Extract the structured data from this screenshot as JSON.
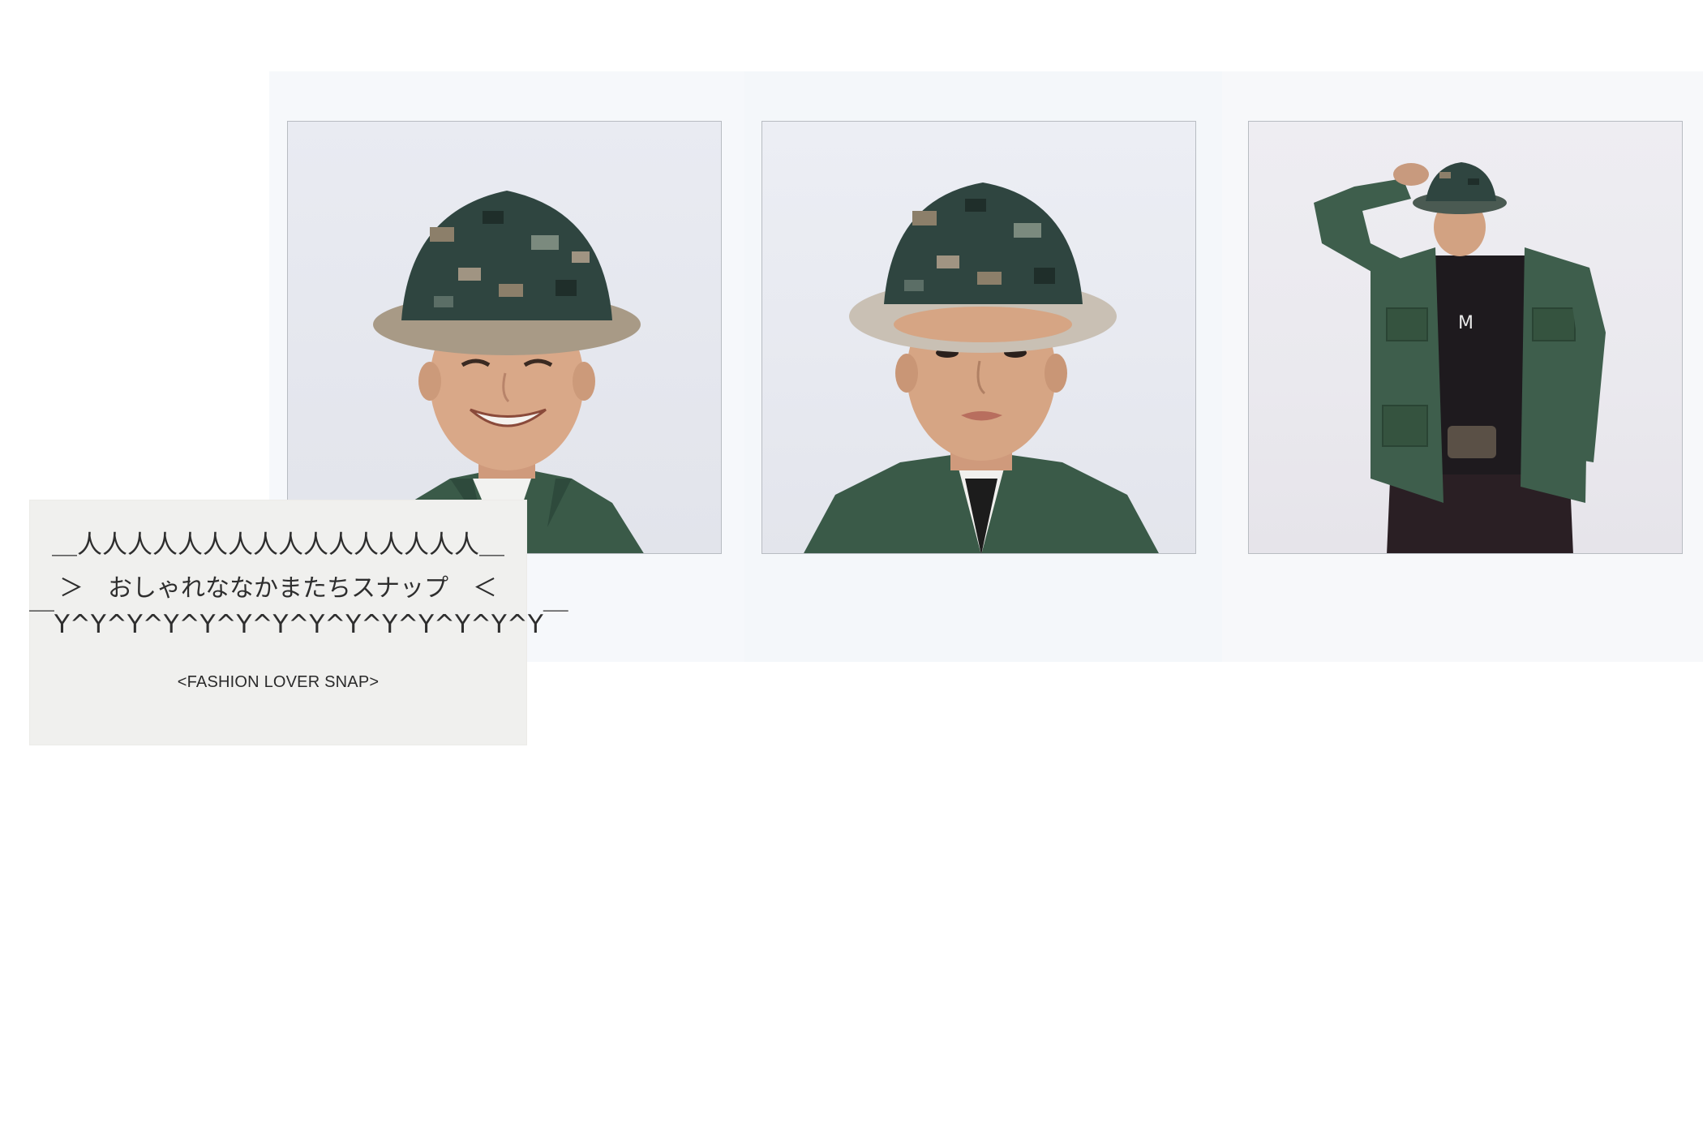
{
  "photos": [
    {
      "subject": "smiling-portrait"
    },
    {
      "subject": "neutral-portrait"
    },
    {
      "subject": "full-body-pose"
    }
  ],
  "caption": {
    "border_top": "＿人人人人人人人人人人人人人人人人＿",
    "title": "＞　おしゃれななかまたちスナップ　＜",
    "border_bottom": "￣Y^Y^Y^Y^Y^Y^Y^Y^Y^Y^Y^Y^Y^Y￣",
    "subtitle": "<FASHION LOVER SNAP>"
  },
  "colors": {
    "jacket": "#3a5a48",
    "hat_dark": "#2f4540",
    "skin": "#d9a888",
    "background": "#ffffff"
  }
}
